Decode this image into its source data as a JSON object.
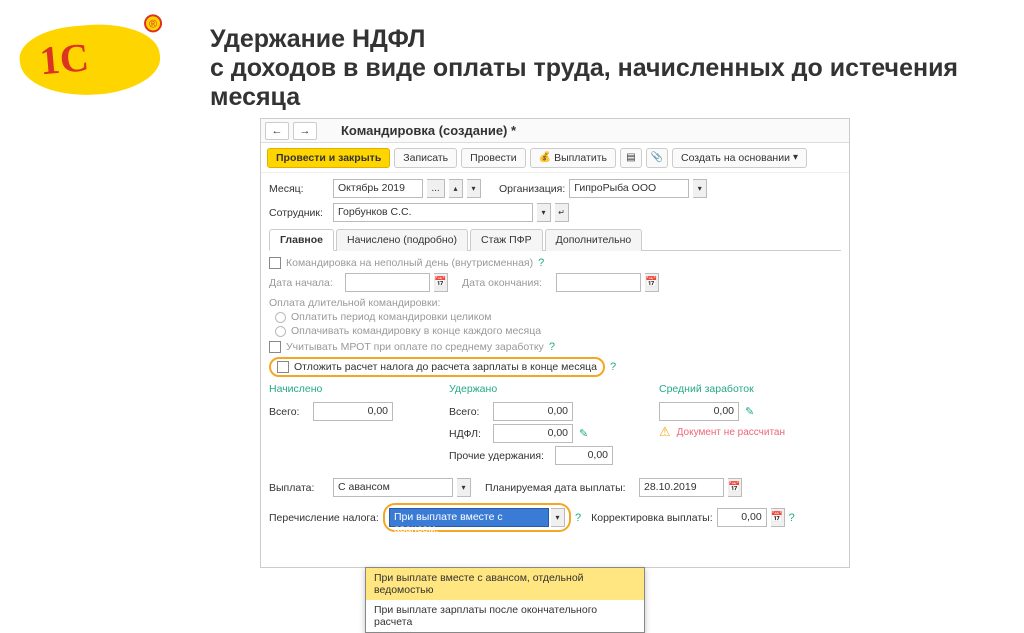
{
  "slide": {
    "title": "Удержание НДФЛ\nс доходов в виде оплаты труда, начисленных до истечения месяца",
    "logo_text": "1С",
    "logo_reg": "®"
  },
  "window": {
    "title": "Командировка (создание) *"
  },
  "toolbar": {
    "post_close": "Провести и закрыть",
    "save": "Записать",
    "post": "Провести",
    "pay": "Выплатить",
    "create_based": "Создать на основании"
  },
  "fields": {
    "month_lbl": "Месяц:",
    "month_val": "Октябрь 2019",
    "org_lbl": "Организация:",
    "org_val": "ГипроРыба ООО",
    "emp_lbl": "Сотрудник:",
    "emp_val": "Горбунков С.С."
  },
  "tabs": {
    "main": "Главное",
    "accrued": "Начислено (подробно)",
    "pfr": "Стаж ПФР",
    "extra": "Дополнительно"
  },
  "main_tab": {
    "partial_day": "Командировка на неполный день (внутрисменная)",
    "date_start_lbl": "Дата начала:",
    "date_end_lbl": "Дата окончания:",
    "long_trip_lbl": "Оплата длительной командировки:",
    "opt_whole": "Оплатить период командировки целиком",
    "opt_monthly": "Оплачивать командировку в конце каждого месяца",
    "mrot": "Учитывать МРОТ при оплате по среднему заработку",
    "defer_tax": "Отложить расчет налога до расчета зарплаты в конце месяца"
  },
  "sums": {
    "accrued_h": "Начислено",
    "withheld_h": "Удержано",
    "avg_h": "Средний заработок",
    "total_lbl": "Всего:",
    "ndfl_lbl": "НДФЛ:",
    "other_lbl": "Прочие удержания:",
    "zero": "0,00",
    "not_calc": "Документ не рассчитан"
  },
  "payment": {
    "pay_lbl": "Выплата:",
    "pay_val": "С авансом",
    "plan_date_lbl": "Планируемая дата выплаты:",
    "plan_date_val": "28.10.2019",
    "tax_transfer_lbl": "Перечисление налога:",
    "tax_sel": "При выплате вместе с авансом,",
    "corr_lbl": "Корректировка выплаты:",
    "corr_val": "0,00"
  },
  "dropdown": {
    "opt1": "При выплате вместе с авансом, отдельной ведомостью",
    "opt2": "При выплате зарплаты после окончательного расчета"
  },
  "glyph": {
    "q": "?",
    "dots": "...",
    "cal": "📅",
    "down": "▾",
    "up": "▴",
    "left": "←",
    "right": "→",
    "attach": "📎",
    "doc": "▤",
    "coin": "💰",
    "pencil": "✎",
    "warn": "⚠"
  }
}
